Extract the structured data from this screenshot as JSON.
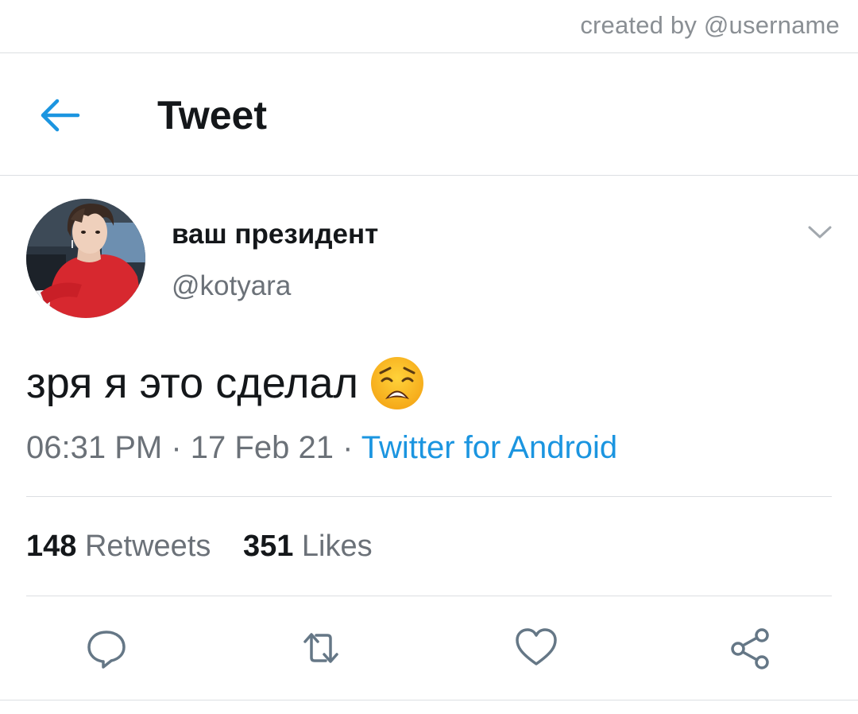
{
  "credit": "created by @username",
  "header": {
    "title": "Tweet",
    "back_icon": "arrow-left-icon"
  },
  "tweet": {
    "display_name": "ваш президент",
    "handle": "@kotyara",
    "text": "зря я это сделал",
    "emoji": "weary-face",
    "time": "06:31 PM",
    "date": "17 Feb 21",
    "separator": "·",
    "source": "Twitter for Android"
  },
  "stats": {
    "retweets_count": "148",
    "retweets_label": "Retweets",
    "likes_count": "351",
    "likes_label": "Likes"
  },
  "actions": [
    "reply-icon",
    "retweet-icon",
    "like-icon",
    "share-icon"
  ],
  "colors": {
    "accent": "#1b95e0",
    "text": "#14171a",
    "muted": "#6b7178",
    "divider": "#dcdfe2"
  }
}
